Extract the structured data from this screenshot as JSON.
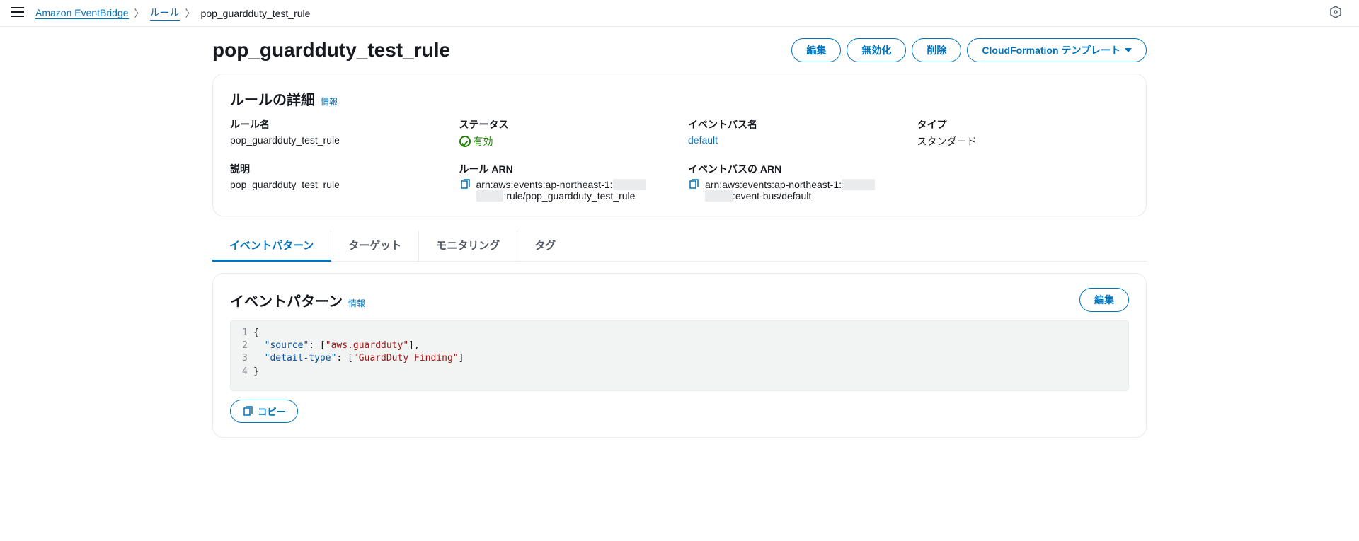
{
  "breadcrumb": {
    "service": "Amazon EventBridge",
    "rules": "ルール",
    "current": "pop_guardduty_test_rule"
  },
  "header": {
    "title": "pop_guardduty_test_rule",
    "actions": {
      "edit": "編集",
      "disable": "無効化",
      "delete": "削除",
      "cloudformation": "CloudFormation テンプレート"
    }
  },
  "details": {
    "panel_title": "ルールの詳細",
    "info": "情報",
    "ruleName": {
      "label": "ルール名",
      "value": "pop_guardduty_test_rule"
    },
    "status": {
      "label": "ステータス",
      "value": "有効"
    },
    "eventBusName": {
      "label": "イベントバス名",
      "value": "default"
    },
    "type": {
      "label": "タイプ",
      "value": "スタンダード"
    },
    "description": {
      "label": "説明",
      "value": "pop_guardduty_test_rule"
    },
    "ruleArn": {
      "label": "ルール ARN",
      "prefix": "arn:aws:events:ap-northeast-1:",
      "suffix": ":rule/pop_guardduty_test_rule"
    },
    "eventBusArn": {
      "label": "イベントバスの ARN",
      "prefix": "arn:aws:events:ap-northeast-1:",
      "suffix": ":event-bus/default"
    }
  },
  "tabs": {
    "eventPattern": "イベントパターン",
    "targets": "ターゲット",
    "monitoring": "モニタリング",
    "tags": "タグ"
  },
  "pattern": {
    "panel_title": "イベントパターン",
    "info": "情報",
    "edit": "編集",
    "copy": "コピー",
    "lines": [
      {
        "n": "1",
        "raw": "{"
      },
      {
        "n": "2",
        "pre": "  ",
        "key": "\"source\"",
        "mid": ": [",
        "val": "\"aws.guardduty\"",
        "post": "],"
      },
      {
        "n": "3",
        "pre": "  ",
        "key": "\"detail-type\"",
        "mid": ": [",
        "val": "\"GuardDuty Finding\"",
        "post": "]"
      },
      {
        "n": "4",
        "raw": "}"
      }
    ]
  }
}
